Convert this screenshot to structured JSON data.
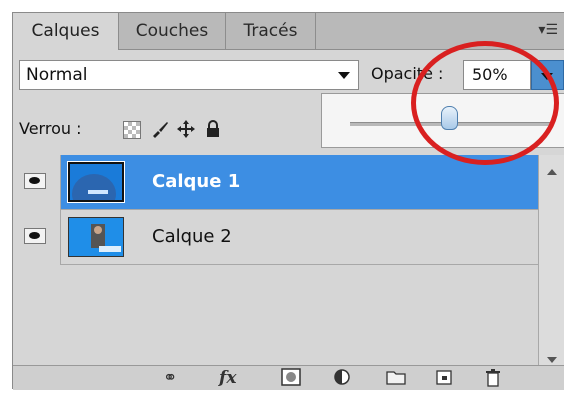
{
  "tabs": [
    {
      "label": "Calques",
      "active": true
    },
    {
      "label": "Couches",
      "active": false
    },
    {
      "label": "Tracés",
      "active": false
    }
  ],
  "panel_menu_icon": "panel-menu-icon",
  "options": {
    "blend_mode": "Normal",
    "opacity_label": "Opacité :",
    "opacity_value": "50%",
    "slider_value_percent": 50
  },
  "lock": {
    "label": "Verrou :",
    "icons": [
      "lock-transparency-icon",
      "lock-paint-brush-icon",
      "lock-move-icon",
      "lock-all-icon"
    ]
  },
  "layers": [
    {
      "name": "Calque 1",
      "visible": true,
      "selected": true
    },
    {
      "name": "Calque 2",
      "visible": true,
      "selected": false
    }
  ],
  "bottom_icons": [
    "link-icon",
    "fx-icon",
    "mask-icon",
    "adjustment-icon",
    "folder-icon",
    "new-layer-icon",
    "trash-icon"
  ],
  "fx_label": "fx",
  "colors": {
    "selected_row": "#3d8ee3",
    "annotation": "#d92020",
    "panel_bg": "#d6d6d6"
  }
}
